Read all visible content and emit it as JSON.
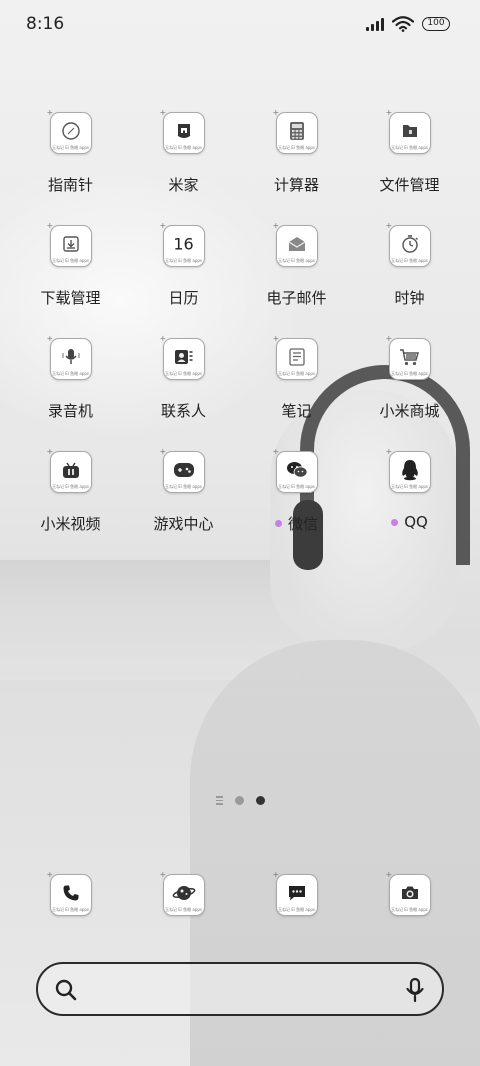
{
  "status_bar": {
    "time": "8:16",
    "battery": "100",
    "icons": [
      "signal-icon",
      "wifi-icon",
      "battery-icon"
    ]
  },
  "apps": [
    {
      "label": "指南针",
      "icon": "compass-icon"
    },
    {
      "label": "米家",
      "icon": "mi-home-icon"
    },
    {
      "label": "计算器",
      "icon": "calculator-icon"
    },
    {
      "label": "文件管理",
      "icon": "file-manager-icon"
    },
    {
      "label": "下载管理",
      "icon": "download-icon"
    },
    {
      "label": "日历",
      "icon": "calendar-icon",
      "glyph_text": "16"
    },
    {
      "label": "电子邮件",
      "icon": "email-icon"
    },
    {
      "label": "时钟",
      "icon": "clock-icon"
    },
    {
      "label": "录音机",
      "icon": "recorder-icon"
    },
    {
      "label": "联系人",
      "icon": "contacts-icon"
    },
    {
      "label": "笔记",
      "icon": "notes-icon"
    },
    {
      "label": "小米商城",
      "icon": "shop-icon"
    },
    {
      "label": "小米视频",
      "icon": "video-icon"
    },
    {
      "label": "游戏中心",
      "icon": "game-center-icon"
    },
    {
      "label": "微信",
      "icon": "wechat-icon",
      "badge": true
    },
    {
      "label": "QQ",
      "icon": "qq-icon",
      "badge": true
    }
  ],
  "icon_caption": "玉ね记 Ei 鱼眼 apps",
  "badge_color": "#c77ee6",
  "page_indicator": {
    "pages": 2,
    "active": 2
  },
  "dock": [
    {
      "icon": "phone-icon"
    },
    {
      "icon": "browser-icon"
    },
    {
      "icon": "messages-icon"
    },
    {
      "icon": "camera-icon"
    }
  ],
  "search": {
    "icons": [
      "search-icon",
      "microphone-icon"
    ]
  }
}
